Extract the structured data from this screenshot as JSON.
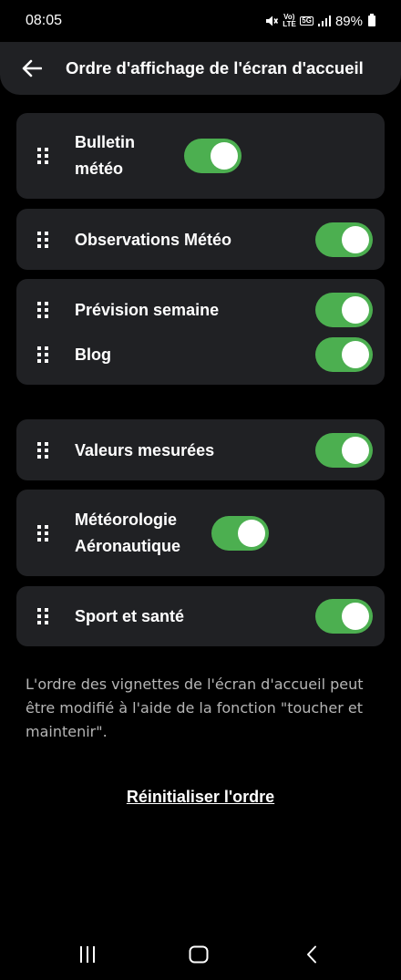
{
  "status_bar": {
    "time": "08:05",
    "volte_label": "Vo) LTE",
    "network_label": "5G",
    "battery": "89%"
  },
  "header": {
    "back_icon": "arrow-left-icon",
    "title": "Ordre d'affichage de l'écran d'accueil"
  },
  "items": [
    {
      "label": "Bulletin météo",
      "enabled": true
    },
    {
      "label": "Observations Météo",
      "enabled": true
    },
    {
      "label": "Prévision semaine",
      "enabled": true
    },
    {
      "label": "Blog",
      "enabled": true
    },
    {
      "label": "Valeurs mesurées",
      "enabled": true
    },
    {
      "label": "Météorologie Aéronautique",
      "enabled": true
    },
    {
      "label": "Sport et santé",
      "enabled": true
    }
  ],
  "hint": "L'ordre des vignettes de l'écran d'accueil peut être modifié à l'aide de la fonction \"toucher et maintenir\".",
  "reset_label": "Réinitialiser l'ordre",
  "colors": {
    "background": "#000000",
    "card": "#202124",
    "toggle_on": "#4caf50",
    "hint_text": "#b5b5b5"
  },
  "navbar": {
    "recents_icon": "recent-apps-icon",
    "home_icon": "home-icon",
    "back_icon": "back-chevron-icon"
  }
}
